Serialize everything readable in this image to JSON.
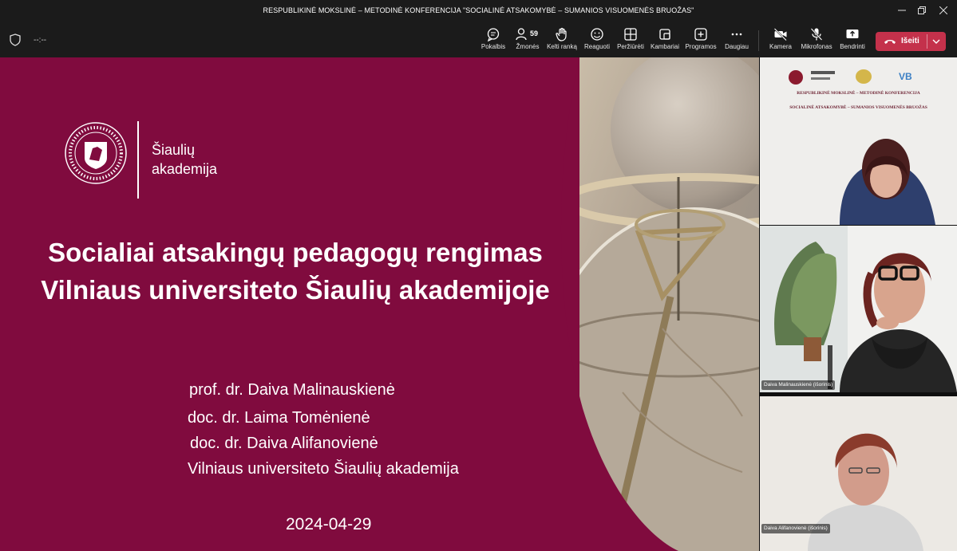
{
  "window": {
    "title": "RESPUBLIKINĖ MOKSLINĖ – METODINĖ KONFERENCIJA \"SOCIALINĖ ATSAKOMYBĖ – SUMANIOS VISUOMENĖS BRUOŽAS\""
  },
  "toolbar": {
    "timer": "--:--",
    "items": [
      {
        "label": "Pokalbis",
        "icon": "chat-icon"
      },
      {
        "label": "Žmonės",
        "icon": "people-icon",
        "count": "59"
      },
      {
        "label": "Kelti ranką",
        "icon": "raise-hand-icon"
      },
      {
        "label": "Reaguoti",
        "icon": "react-icon"
      },
      {
        "label": "Peržiūrėti",
        "icon": "view-icon"
      },
      {
        "label": "Kambariai",
        "icon": "rooms-icon"
      },
      {
        "label": "Programos",
        "icon": "apps-icon"
      },
      {
        "label": "Daugiau",
        "icon": "more-icon"
      },
      {
        "label": "Kamera",
        "icon": "camera-icon"
      },
      {
        "label": "Mikrofonas",
        "icon": "mic-off-icon"
      },
      {
        "label": "Bendrinti",
        "icon": "share-icon"
      }
    ],
    "leave_label": "Išeiti",
    "leave_color": "#c4314b"
  },
  "slide": {
    "bg_color": "#800b3e",
    "logo_line1": "Šiaulių",
    "logo_line2": "akademija",
    "title_line1": "Socialiai atsakingų pedagogų rengimas",
    "title_line2": "Vilniaus universiteto Šiaulių akademijoje",
    "authors": [
      "prof. dr. Daiva Malinauskienė",
      "doc. dr. Laima Tomėnienė",
      "doc. dr. Daiva Alifanovienė",
      "Vilniaus universiteto Šiaulių akademija"
    ],
    "date": "2024-04-29"
  },
  "participants": {
    "banner_line1": "RESPUBLIKINĖ MOKSLINĖ – METODINĖ KONFERENCIJA",
    "banner_line2": "SOCIALINĖ ATSAKOMYBĖ – SUMANIOS VISUOMENĖS BRUOŽAS",
    "tile2_name": "Daiva Malinauskienė (išorinis)",
    "tile3_name": "Daiva Alifanovienė (išorinis)"
  }
}
